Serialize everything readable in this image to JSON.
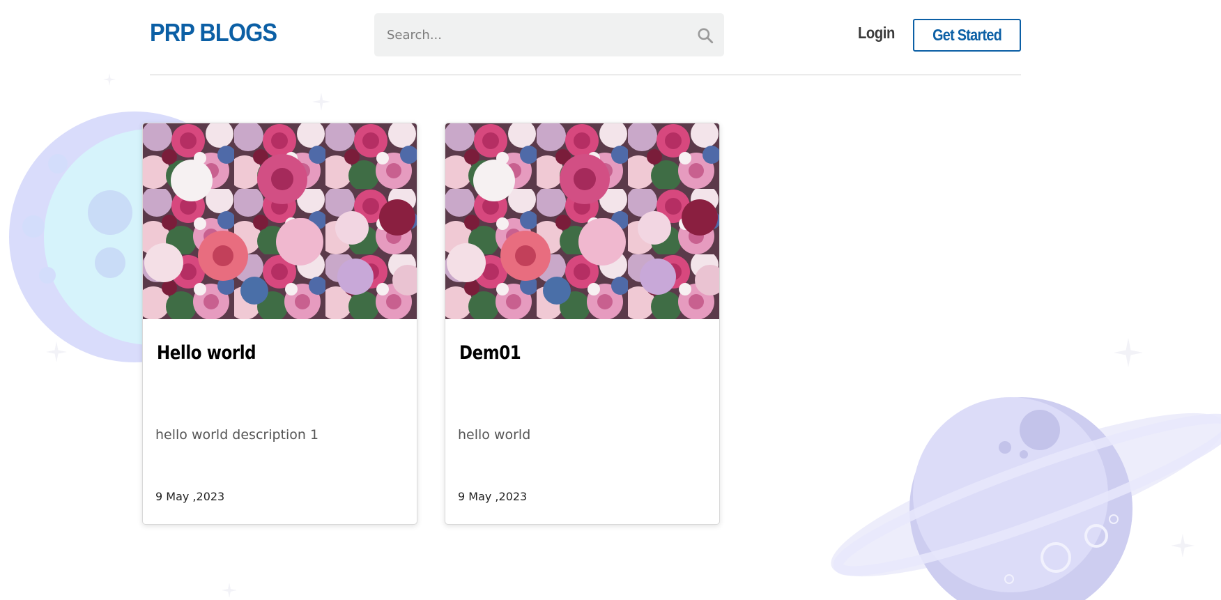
{
  "brand": {
    "logo_text": "PRP BLOGS",
    "color": "#0b5fa5"
  },
  "search": {
    "placeholder": "Search...",
    "value": "",
    "icon": "search-icon"
  },
  "nav": {
    "login_label": "Login",
    "get_started_label": "Get Started"
  },
  "posts": [
    {
      "title": "Hello world",
      "description": "hello world description 1",
      "date": "9 May ,2023",
      "image": "flower-bouquet-image"
    },
    {
      "title": "Dem01",
      "description": "hello world",
      "date": "9 May ,2023",
      "image": "flower-bouquet-image"
    }
  ],
  "decorations": [
    "moon-illustration",
    "ringed-planet-illustration",
    "star-icon"
  ],
  "colors": {
    "accent": "#0b5fa5",
    "header_bg": "#ffffff",
    "search_bg": "#f0f1f1",
    "planet": "#d4d4f5"
  }
}
